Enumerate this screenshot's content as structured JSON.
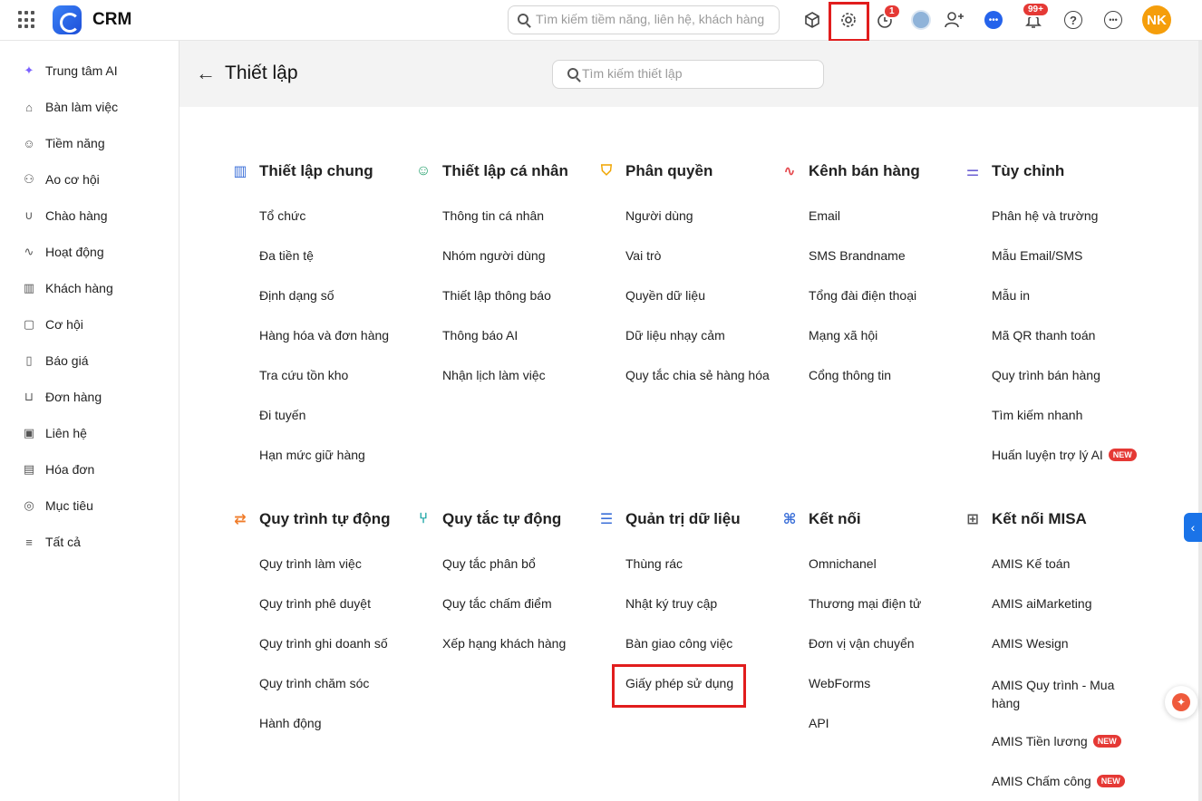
{
  "app": {
    "title": "CRM"
  },
  "topbar": {
    "search_placeholder": "Tìm kiếm tiềm năng, liên hệ, khách hàng",
    "timer_badge": "1",
    "notification_badge": "99+",
    "avatar_initials": "NK"
  },
  "sidebar": {
    "items": [
      {
        "label": "Trung tâm AI",
        "icon": "sparkle-icon"
      },
      {
        "label": "Bàn làm việc",
        "icon": "home-icon"
      },
      {
        "label": "Tiềm năng",
        "icon": "user-circle-icon"
      },
      {
        "label": "Ao cơ hội",
        "icon": "users-icon"
      },
      {
        "label": "Chào hàng",
        "icon": "magnet-icon"
      },
      {
        "label": "Hoạt động",
        "icon": "activity-icon"
      },
      {
        "label": "Khách hàng",
        "icon": "building-icon"
      },
      {
        "label": "Cơ hội",
        "icon": "chat-icon"
      },
      {
        "label": "Báo giá",
        "icon": "document-icon"
      },
      {
        "label": "Đơn hàng",
        "icon": "cart-icon"
      },
      {
        "label": "Liên hệ",
        "icon": "contact-icon"
      },
      {
        "label": "Hóa đơn",
        "icon": "invoice-icon"
      },
      {
        "label": "Mục tiêu",
        "icon": "target-icon"
      },
      {
        "label": "Tất cả",
        "icon": "menu-icon"
      }
    ]
  },
  "header": {
    "title": "Thiết lập",
    "search_placeholder": "Tìm kiếm thiết lập"
  },
  "sections": [
    {
      "title": "Thiết lập chung",
      "icon": "building-icon",
      "color": "#3b6fd8",
      "items": [
        "Tổ chức",
        "Đa tiền tệ",
        "Định dạng số",
        "Hàng hóa và đơn hàng",
        "Tra cứu tồn kho",
        "Đi tuyến",
        "Hạn mức giữ hàng"
      ]
    },
    {
      "title": "Thiết lập cá nhân",
      "icon": "user-check-icon",
      "color": "#22a06b",
      "items": [
        "Thông tin cá nhân",
        "Nhóm người dùng",
        "Thiết lập thông báo",
        "Thông báo AI",
        "Nhận lịch làm việc"
      ]
    },
    {
      "title": "Phân quyền",
      "icon": "shield-icon",
      "color": "#f0a500",
      "items": [
        "Người dùng",
        "Vai trò",
        "Quyền dữ liệu",
        "Dữ liệu nhạy cảm",
        "Quy tắc chia sẻ hàng hóa"
      ]
    },
    {
      "title": "Kênh bán hàng",
      "icon": "pulse-icon",
      "color": "#e5484d",
      "items": [
        "Email",
        "SMS Brandname",
        "Tổng đài điện thoại",
        "Mạng xã hội",
        "Cổng thông tin"
      ]
    },
    {
      "title": "Tùy chỉnh",
      "icon": "sliders-icon",
      "color": "#6b5fd3",
      "items": [
        "Phân hệ và trường",
        "Mẫu Email/SMS",
        "Mẫu in",
        "Mã QR thanh toán",
        "Quy trình bán hàng",
        "Tìm kiếm nhanh",
        "Huấn luyện trợ lý AI"
      ]
    },
    {
      "title": "Quy trình tự động",
      "icon": "repeat-icon",
      "color": "#f07c2a",
      "items": [
        "Quy trình làm việc",
        "Quy trình phê duyệt",
        "Quy trình ghi doanh số",
        "Quy trình chăm sóc",
        "Hành động"
      ]
    },
    {
      "title": "Quy tắc tự động",
      "icon": "branch-icon",
      "color": "#14a3a3",
      "items": [
        "Quy tắc phân bổ",
        "Quy tắc chấm điểm",
        "Xếp hạng khách hàng"
      ]
    },
    {
      "title": "Quản trị dữ liệu",
      "icon": "database-icon",
      "color": "#3b6fd8",
      "items": [
        "Thùng rác",
        "Nhật ký truy cập",
        "Bàn giao công việc",
        "Giấy phép sử dụng"
      ]
    },
    {
      "title": "Kết nối",
      "icon": "command-icon",
      "color": "#3b6fd8",
      "items": [
        "Omnichanel",
        "Thương mại điện tử",
        "Đơn vị vận chuyển",
        "WebForms",
        "API"
      ]
    },
    {
      "title": "Kết nối MISA",
      "icon": "grid-icon",
      "color": "#555555",
      "items": [
        "AMIS Kế toán",
        "AMIS aiMarketing",
        "AMIS Wesign",
        "AMIS Quy trình - Mua hàng",
        "AMIS Tiền lương",
        "AMIS Chấm công"
      ]
    }
  ],
  "new_label": "NEW"
}
